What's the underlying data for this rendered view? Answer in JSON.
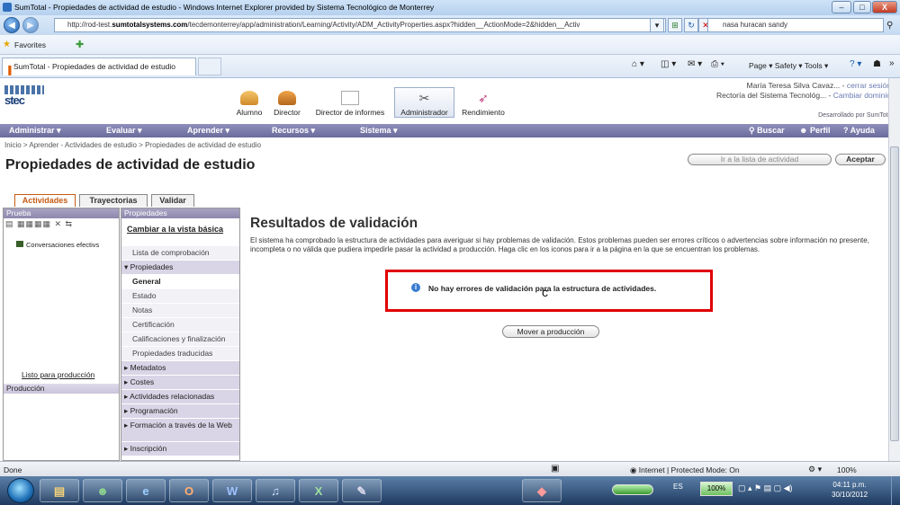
{
  "window": {
    "title": "SumTotal - Propiedades de actividad de estudio - Windows Internet Explorer provided by Sistema Tecnológico de Monterrey",
    "minimize": "–",
    "maximize": "□",
    "close": "X"
  },
  "browser": {
    "url_prefix": "http://rod-test.",
    "url_domain": "sumtotalsystems.com",
    "url_rest": "/tecdemonterrey/app/administration/Learning/Activity/ADM_ActivityProperties.aspx?hidden__ActionMode=2&hidden__Activ",
    "search_text": "nasa huracan sandy",
    "favorites_label": "Favorites",
    "tab_label": "SumTotal - Propiedades de actividad de estudio",
    "commands": "Page ▾  Safety ▾  Tools ▾"
  },
  "site": {
    "nav_items": [
      "Alumno",
      "Director",
      "Director de informes",
      "Administrador",
      "Rendimiento"
    ],
    "user_name": "María Teresa Silva Cavaz...",
    "logout": "cerrar sesión",
    "org": "Rectoría del Sistema Tecnológ...",
    "change_domain": "Cambiar dominio",
    "powered_by": "Desarrollado por SumTotal",
    "menu": [
      "Administrar ▾",
      "Evaluar ▾",
      "Aprender ▾",
      "Recursos ▾",
      "Sistema ▾"
    ],
    "search": "Buscar",
    "profile": "Perfil",
    "help": "Ayuda"
  },
  "page": {
    "breadcrumb": "Inicio > Aprender - Actividades de estudio > Propiedades de actividad de estudio",
    "title": "Propiedades de actividad de estudio",
    "btn_list": "Ir a la lista de actividad",
    "btn_accept": "Aceptar",
    "tabs": [
      "Actividades",
      "Trayectorias",
      "Validar"
    ]
  },
  "left": {
    "header": "Prueba",
    "item": "Conversaciones efectivs",
    "ready_link": "Listo para producción",
    "prod_header": "Producción"
  },
  "middle": {
    "header": "Propiedades",
    "switch_link": "Cambiar a la vista básica",
    "rows": [
      {
        "label": "Lista de comprobación",
        "kind": "sub"
      },
      {
        "label": "▾ Propiedades",
        "kind": "grp"
      },
      {
        "label": "General",
        "kind": "sel"
      },
      {
        "label": "Estado",
        "kind": "sub"
      },
      {
        "label": "Notas",
        "kind": "sub"
      },
      {
        "label": "Certificación",
        "kind": "sub"
      },
      {
        "label": "Calificaciones y finalización",
        "kind": "sub"
      },
      {
        "label": "Propiedades traducidas",
        "kind": "sub"
      },
      {
        "label": "▸ Metadatos",
        "kind": "grp"
      },
      {
        "label": "▸ Costes",
        "kind": "grp"
      },
      {
        "label": "▸ Actividades relacionadas",
        "kind": "grp"
      },
      {
        "label": "▸ Programación",
        "kind": "grp"
      },
      {
        "label": "▸ Formación a través de la Web",
        "kind": "grp"
      },
      {
        "label": "▸ Inscripción",
        "kind": "grp"
      }
    ]
  },
  "content": {
    "title": "Resultados de validación",
    "description": "El sistema ha comprobado la estructura de actividades para averiguar si hay problemas de validación. Estos problemas pueden ser errores críticos o advertencias sobre información no presente, incompleta o no válida que pudiera impedirle pasar la actividad a producción. Haga clic en los iconos para ir a la página en la que se encuentran los problemas.",
    "message": "No hay errores de validación para la estructura de actividades.",
    "cursor_char": "c",
    "move_button": "Mover a producción"
  },
  "statusbar": {
    "done": "Done",
    "zone": "Internet | Protected Mode: On",
    "zoom": "100%"
  },
  "taskbar": {
    "lang": "ES",
    "battery": "100%",
    "time": "04:11 p.m.",
    "date": "30/10/2012"
  }
}
